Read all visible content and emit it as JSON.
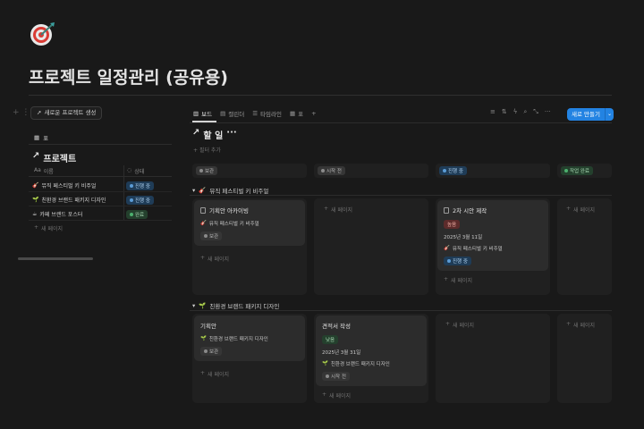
{
  "page": {
    "title": "프로젝트 일정관리 (공유용)"
  },
  "left": {
    "new_project_label": "새로운 프로젝트 생성",
    "view_tab": "표",
    "db_title": "프로젝트",
    "col_name": "이름",
    "col_status": "상태",
    "rows": [
      {
        "emoji": "🎸",
        "name": "뮤직 페스티벌 키 비주얼",
        "status": "진행 중"
      },
      {
        "emoji": "🌱",
        "name": "친환경 브랜드 패키지 디자인",
        "status": "진행 중"
      },
      {
        "emoji": "☕",
        "name": "카페 브랜드 포스터",
        "status": "완료"
      }
    ],
    "new_page": "새 페이지"
  },
  "board": {
    "tabs": [
      "보드",
      "캘린더",
      "타임라인",
      "표"
    ],
    "new_button": "새로 만들기",
    "title": "할 일",
    "title_more": "···",
    "add_filter": "필터 추가",
    "columns": [
      "보관",
      "시작 전",
      "진행 중",
      "작업 완료"
    ],
    "new_page": "새 페이지",
    "group1": {
      "label": "뮤직 페스티벌 키 비주얼",
      "emoji": "🎸",
      "card1": {
        "title": "기획안 아카이빙",
        "project": "뮤직 페스티벌 키 비주얼",
        "status": "보관"
      },
      "card2": {
        "title": "2차 시안 제작",
        "tag": "높음",
        "date": "2025년 3월 11일",
        "project": "뮤직 페스티벌 키 비주얼",
        "status": "진행 중"
      }
    },
    "group2": {
      "label": "친환경 브랜드 패키지 디자인",
      "emoji": "🌱",
      "card1": {
        "title": "기획안",
        "project": "친환경 브랜드 패키지 디자인",
        "status": "보관"
      },
      "card2": {
        "title": "견적서 작성",
        "tag": "낮음",
        "date": "2025년 3월 31일",
        "project": "친환경 브랜드 패키지 디자인",
        "status": "시작 전"
      }
    }
  },
  "colors": {
    "accent": "#2383e2",
    "background": "#191919"
  }
}
